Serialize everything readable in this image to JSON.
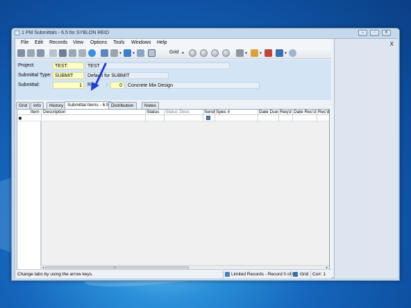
{
  "window": {
    "title": "1 PM Submittals - 6.5 for SYBLON REID",
    "minimize_glyph": "–",
    "restore_glyph": "▫",
    "close_glyph": "✕"
  },
  "menu": {
    "items": [
      "File",
      "Edit",
      "Records",
      "View",
      "Options",
      "Tools",
      "Windows",
      "Help"
    ]
  },
  "toolbar": {
    "grid_label": "Grid",
    "dropdown_glyph": "▼"
  },
  "right_panel": {
    "close_label": "X"
  },
  "form": {
    "project_label": "Project:",
    "project_value": "TEST.",
    "project_name": "TEST",
    "submittal_type_label": "Submittal Type:",
    "submittal_type_value": "SUBMIT",
    "submittal_type_desc": "Default for SUBMIT",
    "submittal_label": "Submittal:",
    "submittal_value": "1",
    "revision_label": "Re",
    "revision_label_tail": ":",
    "revision_value": "0",
    "submittal_desc": "Concrete Mix Design"
  },
  "tabs": [
    "Grid",
    "Info",
    "History",
    "Submittal Items - 6.5",
    "Distribution",
    "Notes"
  ],
  "active_tab": "Submittal Items - 6.5",
  "grid": {
    "columns": [
      "Item",
      "Description",
      "Status",
      "Status Desc",
      "Send",
      "Spec #",
      "Date Due",
      "Req'd",
      "Date Rec'd",
      "Rec'd"
    ],
    "new_row_marker": "✱",
    "scroll_left": "◂",
    "scroll_right": "▸",
    "scroll_grip": "≡"
  },
  "statusbar": {
    "hint": "Change tabs by using the arrow keys.",
    "records": "Limited Records - Record 0 of 0",
    "view": "Grid",
    "company": "Co#: 1"
  },
  "colors": {
    "field_yellow": "#ffffc6",
    "form_bg": "#d3e4f5",
    "annotation_arrow": "#1f3fd0"
  }
}
